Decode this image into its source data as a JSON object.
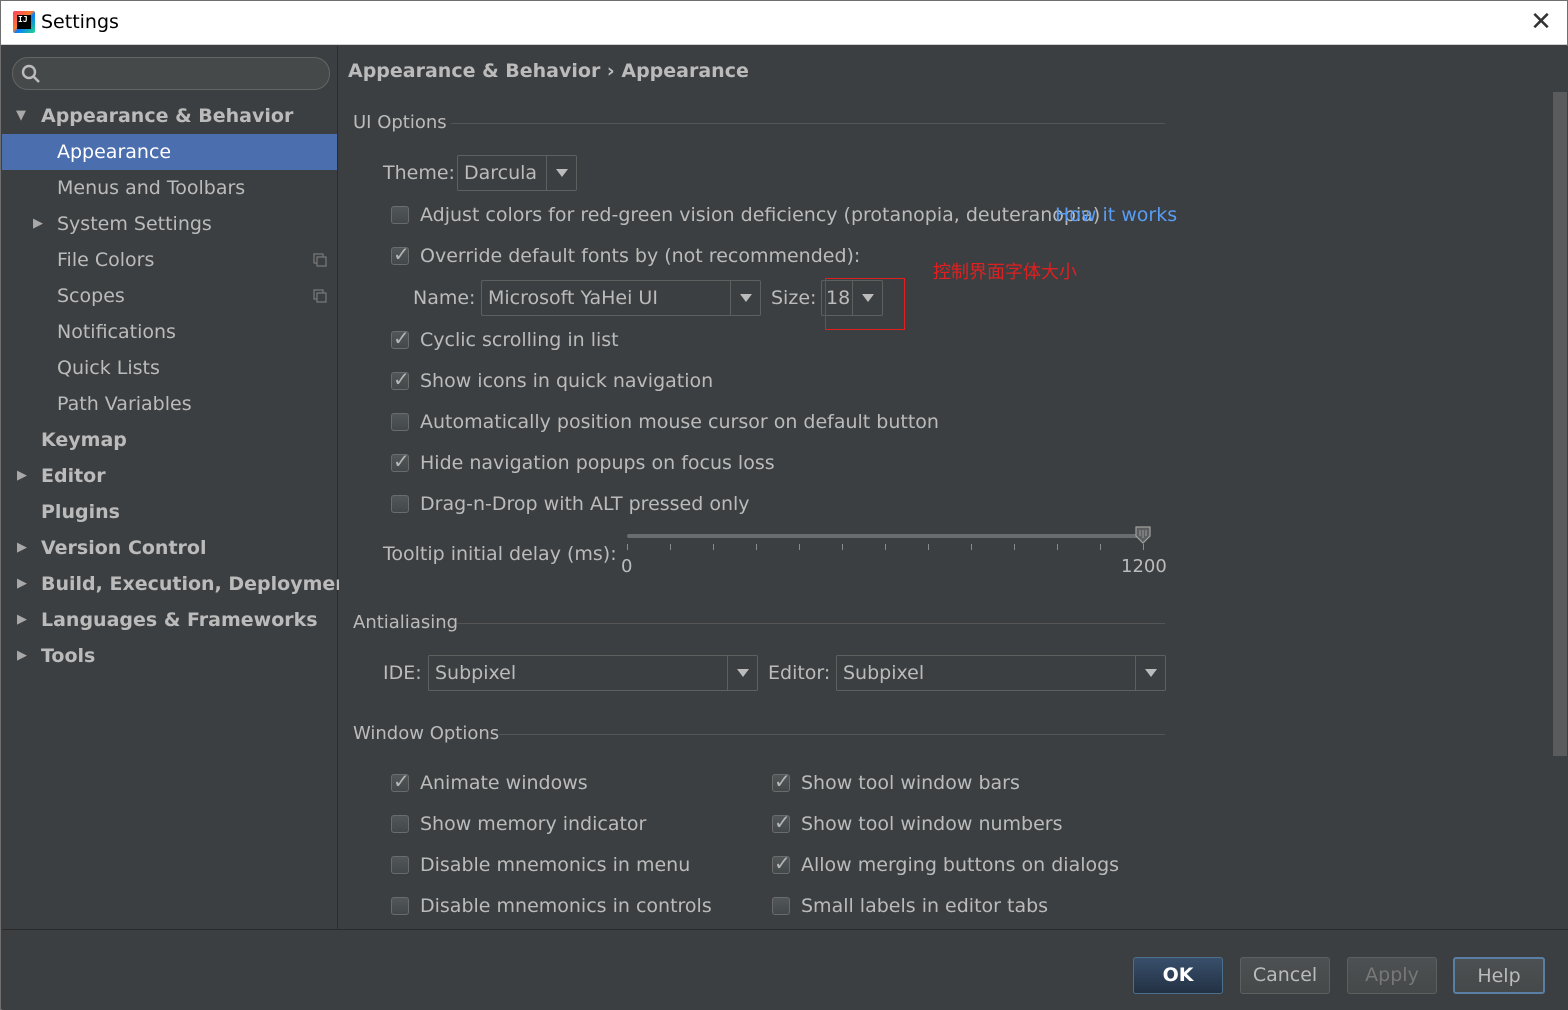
{
  "window": {
    "title": "Settings",
    "close_glyph": "✕",
    "app_icon_text": "IJ"
  },
  "sidebar": {
    "search": {
      "placeholder": "",
      "value": ""
    },
    "items": [
      {
        "label": "Appearance & Behavior",
        "expanded": true
      },
      {
        "label": "Appearance",
        "selected": true
      },
      {
        "label": "Menus and Toolbars"
      },
      {
        "label": "System Settings",
        "expandable": true
      },
      {
        "label": "File Colors",
        "has_copy_icon": true
      },
      {
        "label": "Scopes",
        "has_copy_icon": true
      },
      {
        "label": "Notifications"
      },
      {
        "label": "Quick Lists"
      },
      {
        "label": "Path Variables"
      },
      {
        "label": "Keymap"
      },
      {
        "label": "Editor",
        "expandable": true
      },
      {
        "label": "Plugins"
      },
      {
        "label": "Version Control",
        "expandable": true
      },
      {
        "label": "Build, Execution, Deployment",
        "expandable": true
      },
      {
        "label": "Languages & Frameworks",
        "expandable": true
      },
      {
        "label": "Tools",
        "expandable": true
      }
    ]
  },
  "content": {
    "breadcrumb": "Appearance & Behavior › Appearance",
    "ui_options": {
      "title": "UI Options",
      "theme_label": "Theme:",
      "theme_value": "Darcula",
      "adjust_colors": {
        "label": "Adjust colors for red-green vision deficiency (protanopia, deuteranopia)",
        "checked": false
      },
      "how_it_works": "How it works",
      "override_fonts": {
        "label": "Override default fonts by (not recommended):",
        "checked": true
      },
      "name_label": "Name:",
      "name_value": "Microsoft YaHei UI",
      "size_label": "Size:",
      "size_value": "18",
      "annotation": "控制界面字体大小",
      "cyclic_scrolling": {
        "label": "Cyclic scrolling in list",
        "checked": true
      },
      "show_icons_nav": {
        "label": "Show icons in quick navigation",
        "checked": true
      },
      "auto_position_mouse": {
        "label": "Automatically position mouse cursor on default button",
        "checked": false
      },
      "hide_nav_popups": {
        "label": "Hide navigation popups on focus loss",
        "checked": true
      },
      "drag_n_drop": {
        "label": "Drag-n-Drop with ALT pressed only",
        "checked": false
      },
      "tooltip_label": "Tooltip initial delay (ms):",
      "tooltip_min": "0",
      "tooltip_max": "1200",
      "tooltip_value": 1200
    },
    "antialiasing": {
      "title": "Antialiasing",
      "ide_label": "IDE:",
      "ide_value": "Subpixel",
      "editor_label": "Editor:",
      "editor_value": "Subpixel"
    },
    "window_options": {
      "title": "Window Options",
      "left": [
        {
          "label": "Animate windows",
          "checked": true
        },
        {
          "label": "Show memory indicator",
          "checked": false
        },
        {
          "label": "Disable mnemonics in menu",
          "checked": false
        },
        {
          "label": "Disable mnemonics in controls",
          "checked": false
        }
      ],
      "right": [
        {
          "label": "Show tool window bars",
          "checked": true
        },
        {
          "label": "Show tool window numbers",
          "checked": true
        },
        {
          "label": "Allow merging buttons on dialogs",
          "checked": true
        },
        {
          "label": "Small labels in editor tabs",
          "checked": false
        }
      ]
    }
  },
  "footer": {
    "ok": "OK",
    "cancel": "Cancel",
    "apply": "Apply",
    "help": "Help"
  },
  "colors": {
    "background": "#3c3f41",
    "selection": "#4b6eaf",
    "link": "#589df6",
    "annotation": "#e02020"
  },
  "icons": {
    "search": "search-icon",
    "expand": "triangle-down-icon",
    "collapse": "triangle-right-icon",
    "copy": "copy-icon",
    "dropdown": "chevron-down-icon",
    "checkmark": "checkmark-icon"
  }
}
